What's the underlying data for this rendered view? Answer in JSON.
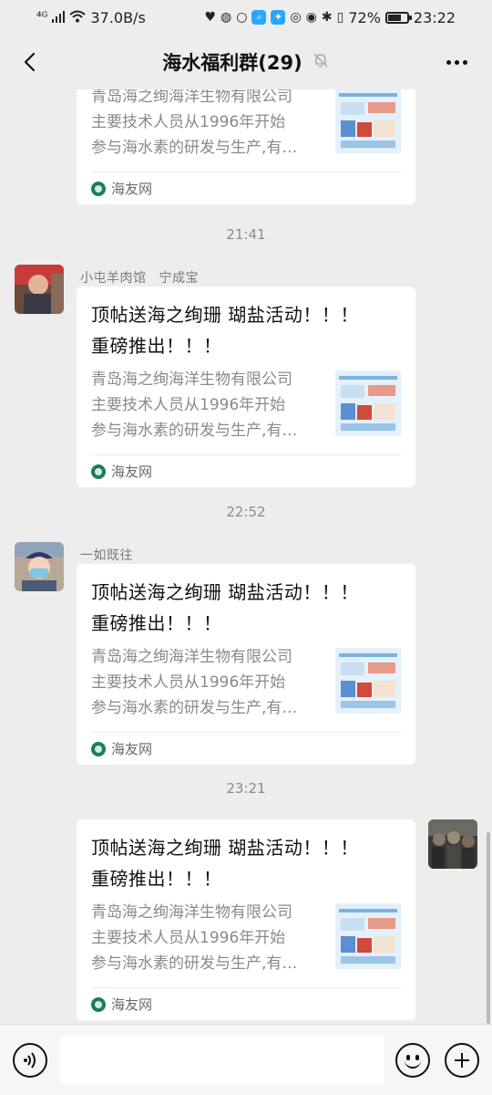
{
  "status_bar": {
    "network": "⁴ᴳ",
    "speed": "37.0B/s",
    "battery": "72%",
    "battery_level": 0.72,
    "time": "23:22"
  },
  "nav": {
    "title": "海水福利群(29)"
  },
  "shared_link": {
    "headline_line1": "顶帖送海之绚珊 瑚盐活动！！！",
    "headline_line2": "重磅推出！！！",
    "desc_line1": "青岛海之绚海洋生物有限公司",
    "desc_line2": "主要技术人员从1996年开始",
    "desc_line3": "参与海水素的研发与生产,有…",
    "source": "海友网"
  },
  "messages": [
    {
      "time": "21:41",
      "sender": "小屯羊肉馆",
      "sender_extra": "宁成宝"
    },
    {
      "time": "22:52",
      "sender": "一如既往"
    },
    {
      "time": "23:21",
      "self": true
    }
  ],
  "input": {
    "placeholder": ""
  },
  "colors": {
    "background": "#ededed",
    "card": "#ffffff",
    "muted_text": "#8a8a8a",
    "source_icon": "#1f7a5e"
  },
  "icons": [
    "back-arrow-icon",
    "mute-bell-icon",
    "more-dots-icon",
    "voice-icon",
    "emoji-icon",
    "plus-icon"
  ]
}
